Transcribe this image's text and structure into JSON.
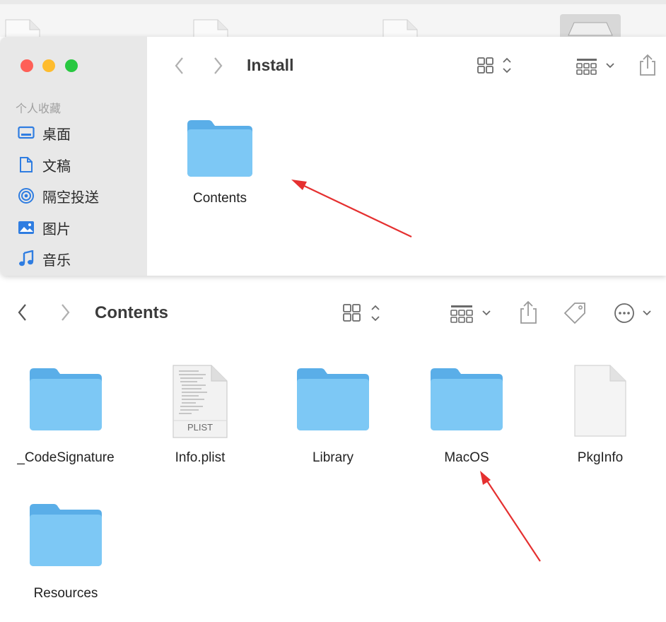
{
  "window1": {
    "title": "Install",
    "sidebar": {
      "heading": "个人收藏",
      "items": [
        {
          "label": "桌面",
          "icon": "desktop-icon"
        },
        {
          "label": "文稿",
          "icon": "document-icon"
        },
        {
          "label": "隔空投送",
          "icon": "airdrop-icon"
        },
        {
          "label": "图片",
          "icon": "photos-icon"
        },
        {
          "label": "音乐",
          "icon": "music-icon"
        }
      ]
    },
    "files": [
      {
        "name": "Contents",
        "kind": "folder"
      }
    ]
  },
  "window2": {
    "title": "Contents",
    "files": [
      {
        "name": "_CodeSignature",
        "kind": "folder"
      },
      {
        "name": "Info.plist",
        "kind": "plist",
        "badge": "PLIST"
      },
      {
        "name": "Library",
        "kind": "folder"
      },
      {
        "name": "MacOS",
        "kind": "folder"
      },
      {
        "name": "PkgInfo",
        "kind": "document"
      },
      {
        "name": "Resources",
        "kind": "folder"
      }
    ]
  },
  "colors": {
    "folder_front": "#7dc8f5",
    "folder_back": "#5aaee8",
    "traffic_red": "#fe5f57",
    "traffic_yellow": "#febc2e",
    "traffic_green": "#28c840",
    "annotation_arrow": "#e53030",
    "sidebar_icon": "#2f7de1"
  }
}
